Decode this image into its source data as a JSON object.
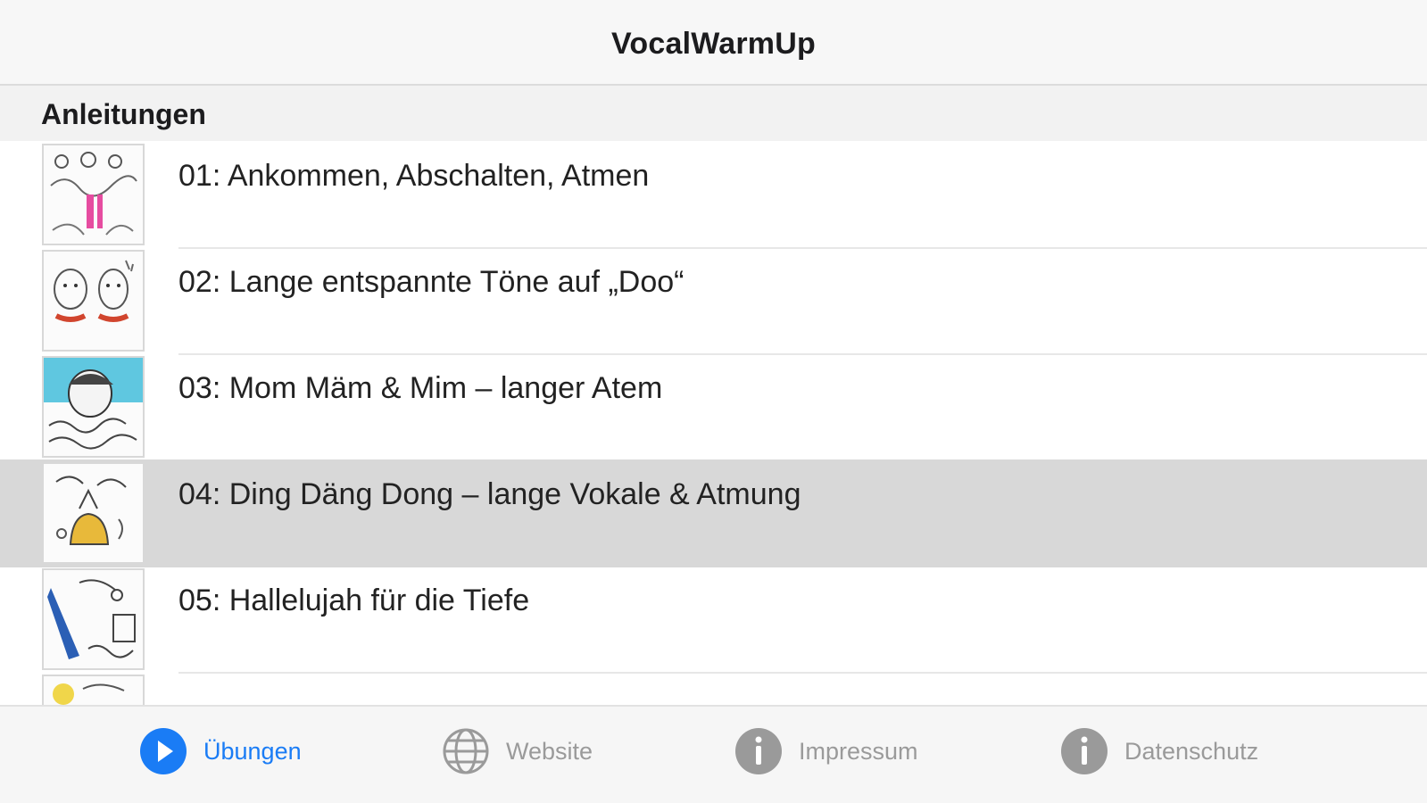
{
  "app": {
    "title": "VocalWarmUp"
  },
  "section": {
    "title": "Anleitungen"
  },
  "exercises": [
    {
      "label": "01: Ankommen, Abschalten, Atmen",
      "selected": false
    },
    {
      "label": "02: Lange entspannte Töne auf „Doo“",
      "selected": false
    },
    {
      "label": "03: Mom Mäm & Mim – langer Atem",
      "selected": false
    },
    {
      "label": "04: Ding Däng Dong – lange Vokale & Atmung",
      "selected": true
    },
    {
      "label": "05: Hallelujah für die Tiefe",
      "selected": false
    }
  ],
  "tabs": [
    {
      "label": "Übungen",
      "icon": "play-circle-icon",
      "active": true
    },
    {
      "label": "Website",
      "icon": "globe-icon",
      "active": false
    },
    {
      "label": "Impressum",
      "icon": "info-icon",
      "active": false
    },
    {
      "label": "Datenschutz",
      "icon": "info-icon",
      "active": false
    }
  ],
  "colors": {
    "accent": "#1a7cf5",
    "inactive": "#9a9a9a",
    "selected_row": "#d8d8d8"
  }
}
